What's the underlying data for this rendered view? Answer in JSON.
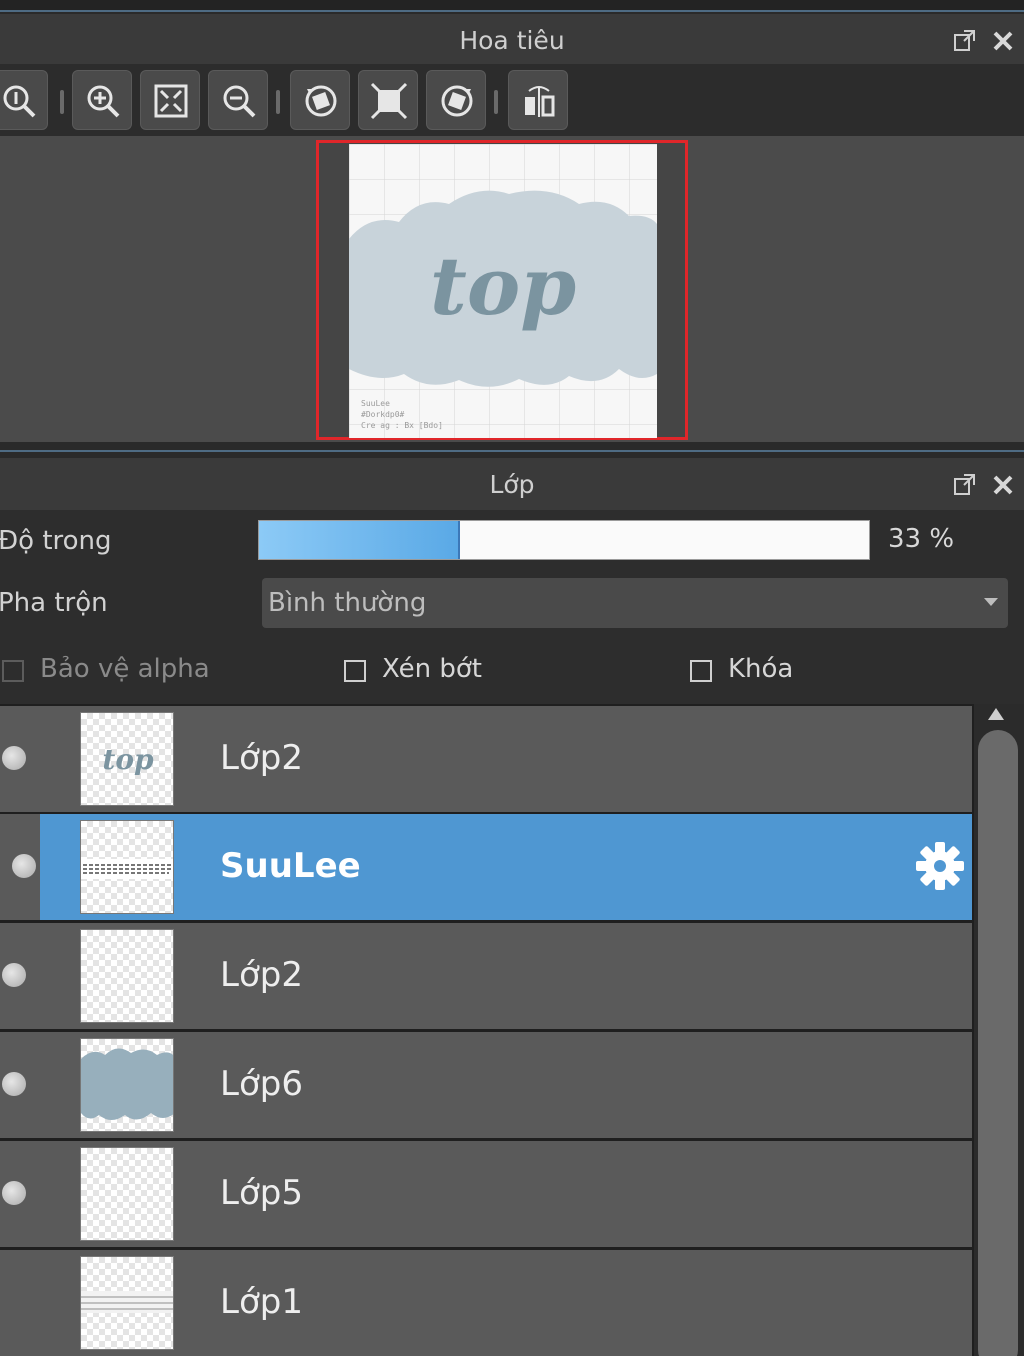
{
  "navigator": {
    "title": "Hoa tiêu",
    "toolbar_icons": [
      "zoom-actual-icon",
      "zoom-in-icon",
      "fit-screen-icon",
      "zoom-out-icon",
      "rotate-left-icon",
      "fit-canvas-icon",
      "rotate-right-icon",
      "flip-horizontal-icon"
    ],
    "canvas_preview_text": "top",
    "canvas_small_text": [
      "SuuLee",
      "#Dorkdp0#",
      "Cre ag : Bx [Bdo]"
    ],
    "frame_color": "#e0262a"
  },
  "layers_panel": {
    "title": "Lớp",
    "opacity_label": "Độ trong",
    "opacity_value": "33 %",
    "opacity_percent": 33,
    "blend_label": "Pha trộn",
    "blend_value": "Bình thường",
    "protect_alpha_label": "Bảo vệ alpha",
    "clipping_label": "Xén bớt",
    "lock_label": "Khóa",
    "layers": [
      {
        "name": "Lớp2",
        "selected": false,
        "visible": true
      },
      {
        "name": "SuuLee",
        "selected": true,
        "visible": true
      },
      {
        "name": "Lớp2",
        "selected": false,
        "visible": true
      },
      {
        "name": "Lớp6",
        "selected": false,
        "visible": true
      },
      {
        "name": "Lớp5",
        "selected": false,
        "visible": true
      },
      {
        "name": "Lớp1",
        "selected": false,
        "visible": false
      }
    ]
  },
  "colors": {
    "accent_selected": "#4f97d2",
    "panel_bg": "#3a3a3a",
    "row_bg": "#5a5a5a"
  }
}
